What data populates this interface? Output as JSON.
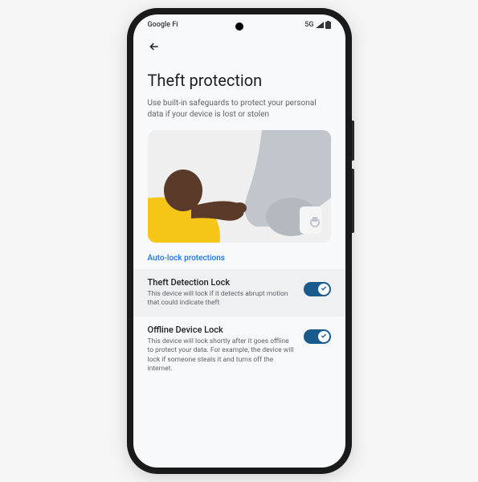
{
  "status": {
    "carrier": "Google Fi",
    "network": "5G"
  },
  "page": {
    "title": "Theft protection",
    "subtitle": "Use built-in safeguards to protect your personal data if your device is lost or stolen"
  },
  "section": {
    "label": "Auto-lock protections"
  },
  "settings": [
    {
      "title": "Theft Detection Lock",
      "desc": "This device will lock if it detects abrupt motion that could indicate theft",
      "enabled": true
    },
    {
      "title": "Offline Device Lock",
      "desc": "This device will lock shortly after it goes offline to protect your data. For example, the device will lock if someone steals it and turns off the internet.",
      "enabled": true
    }
  ]
}
